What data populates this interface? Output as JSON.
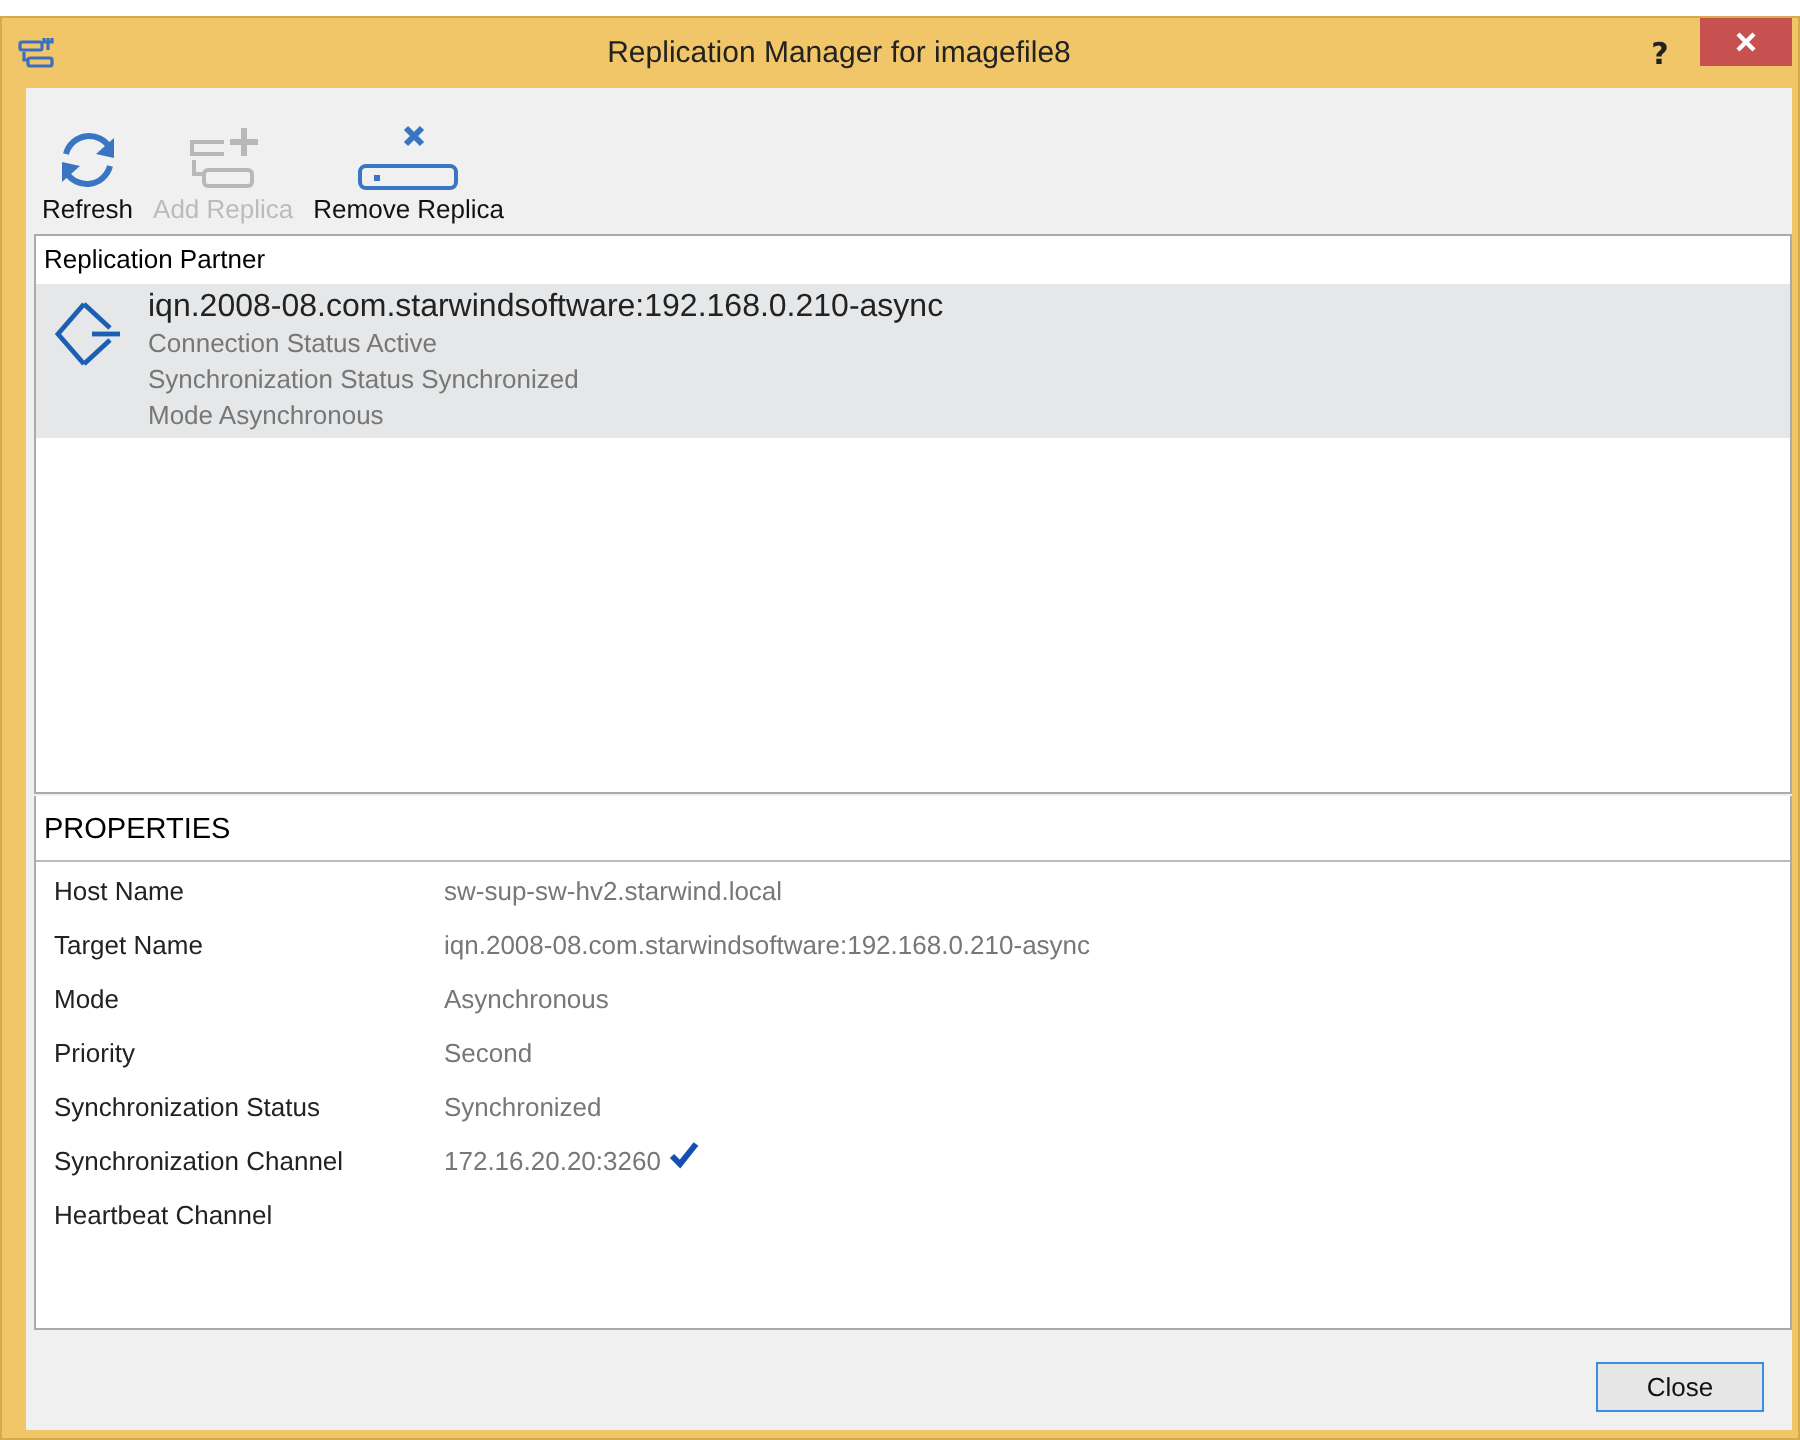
{
  "window": {
    "title": "Replication Manager for imagefile8",
    "help": "?"
  },
  "toolbar": [
    {
      "kind": "refresh",
      "label": "Refresh",
      "disabled": false
    },
    {
      "kind": "add",
      "label": "Add Replica",
      "disabled": true
    },
    {
      "kind": "remove",
      "label": "Remove Replica",
      "disabled": false
    }
  ],
  "partners": {
    "header": "Replication Partner",
    "items": [
      {
        "name": "iqn.2008-08.com.starwindsoftware:192.168.0.210-async",
        "selected": true,
        "details": [
          "Connection Status Active",
          "Synchronization Status Synchronized",
          "Mode Asynchronous"
        ]
      }
    ]
  },
  "properties": {
    "title": "PROPERTIES",
    "rows": [
      {
        "label": "Host Name",
        "value": "sw-sup-sw-hv2.starwind.local",
        "verified": false
      },
      {
        "label": "Target Name",
        "value": "iqn.2008-08.com.starwindsoftware:192.168.0.210-async",
        "verified": false
      },
      {
        "label": "Mode",
        "value": "Asynchronous",
        "verified": false
      },
      {
        "label": "Priority",
        "value": "Second",
        "verified": false
      },
      {
        "label": "Synchronization Status",
        "value": "Synchronized",
        "verified": false
      },
      {
        "label": "Synchronization Channel",
        "value": "172.16.20.20:3260",
        "verified": true
      },
      {
        "label": "Heartbeat Channel",
        "verified": false
      }
    ]
  },
  "buttons": [
    {
      "label": "Close",
      "focused": true
    }
  ]
}
